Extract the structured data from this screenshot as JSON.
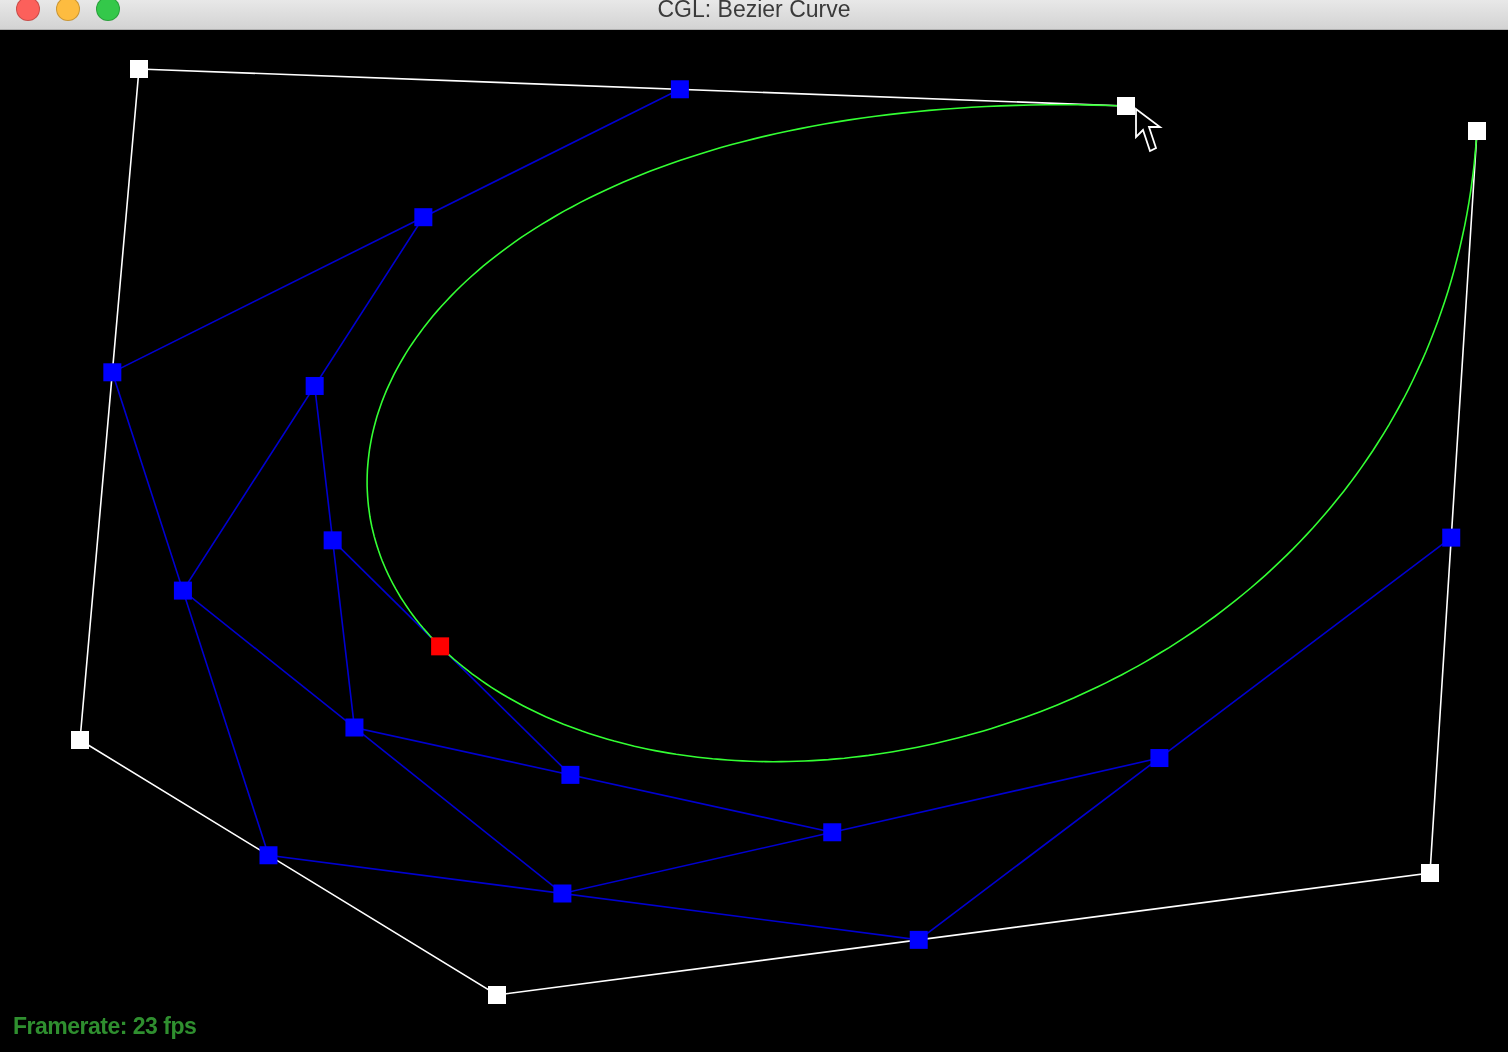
{
  "window": {
    "title": "CGL: Bezier Curve"
  },
  "overlay": {
    "framerate": "Framerate: 23 fps"
  }
}
